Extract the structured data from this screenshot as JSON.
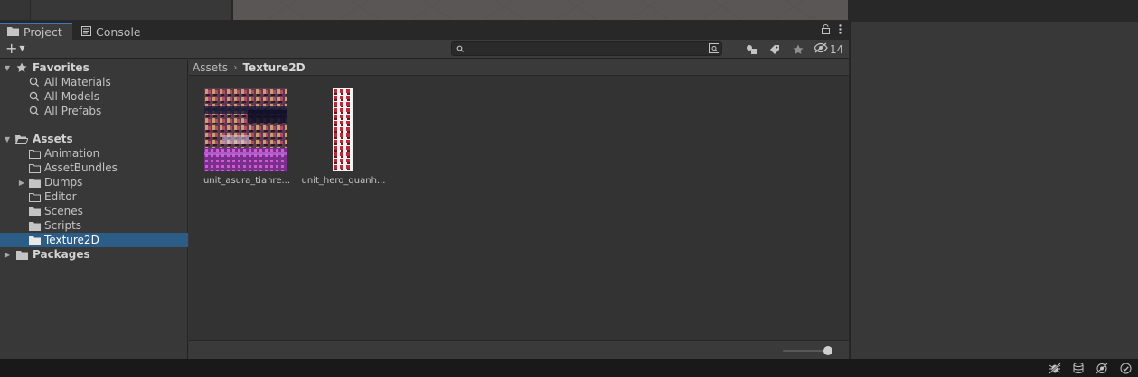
{
  "tabs": [
    {
      "label": "Project",
      "active": true
    },
    {
      "label": "Console",
      "active": false
    }
  ],
  "toolbar": {
    "search_value": "",
    "hidden_count": "14"
  },
  "tree": {
    "favorites": {
      "label": "Favorites",
      "items": [
        "All Materials",
        "All Models",
        "All Prefabs"
      ]
    },
    "assets": {
      "label": "Assets",
      "items": [
        {
          "label": "Animation",
          "expandable": false
        },
        {
          "label": "AssetBundles",
          "expandable": false
        },
        {
          "label": "Dumps",
          "expandable": true
        },
        {
          "label": "Editor",
          "expandable": false
        },
        {
          "label": "Scenes",
          "expandable": false
        },
        {
          "label": "Scripts",
          "expandable": false
        },
        {
          "label": "Texture2D",
          "expandable": false,
          "selected": true
        }
      ]
    },
    "packages": {
      "label": "Packages"
    }
  },
  "breadcrumb": {
    "root": "Assets",
    "current": "Texture2D"
  },
  "assets": [
    {
      "label": "unit_asura_tianre..."
    },
    {
      "label": "unit_hero_quanh..."
    }
  ],
  "zoom_slider": {
    "value": 1.0
  },
  "colors": {
    "selection": "#2c5d87",
    "tab_accent": "#3a79bb",
    "panel": "#383838",
    "content": "#333333"
  }
}
